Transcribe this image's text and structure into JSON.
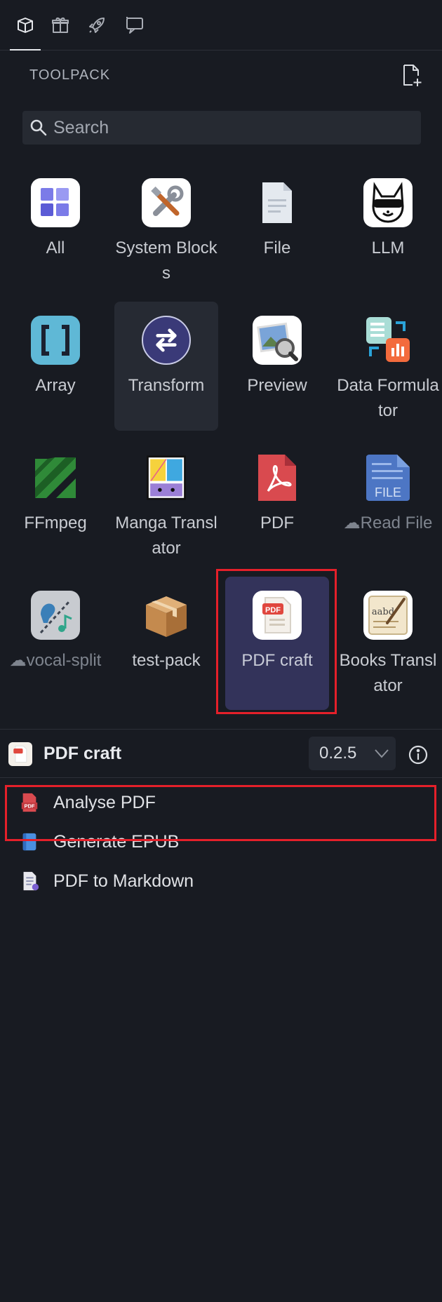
{
  "top_tabs": [
    {
      "name": "toolpack-tab",
      "icon": "box-icon",
      "active": true
    },
    {
      "name": "gift-tab",
      "icon": "gift-icon",
      "active": false
    },
    {
      "name": "rocket-tab",
      "icon": "rocket-icon",
      "active": false
    },
    {
      "name": "chat-tab",
      "icon": "chat-icon",
      "active": false
    }
  ],
  "toolpack": {
    "section_title": "TOOLPACK",
    "search_placeholder": "Search"
  },
  "packs": [
    {
      "label": "All",
      "icon": "all-grid-icon",
      "dim": false
    },
    {
      "label": "System Blocks",
      "icon": "tools-icon",
      "dim": false
    },
    {
      "label": "File",
      "icon": "file-icon",
      "dim": false
    },
    {
      "label": "LLM",
      "icon": "llm-fox-icon",
      "dim": false
    },
    {
      "label": "Array",
      "icon": "brackets-icon",
      "dim": false
    },
    {
      "label": "Transform",
      "icon": "transform-icon",
      "dim": false
    },
    {
      "label": "Preview",
      "icon": "preview-icon",
      "dim": false
    },
    {
      "label": "Data Formulator",
      "icon": "data-formulator-icon",
      "dim": false
    },
    {
      "label": "FFmpeg",
      "icon": "ffmpeg-icon",
      "dim": false
    },
    {
      "label": "Manga Translator",
      "icon": "manga-icon",
      "dim": false
    },
    {
      "label": "PDF",
      "icon": "pdf-icon",
      "dim": false
    },
    {
      "label": "Read File",
      "icon": "read-file-icon",
      "dim": true
    },
    {
      "label": "vocal-split",
      "icon": "vocal-split-icon",
      "dim": true
    },
    {
      "label": "test-pack",
      "icon": "package-box-icon",
      "dim": false
    },
    {
      "label": "PDF craft",
      "icon": "pdf-craft-icon",
      "dim": false
    },
    {
      "label": "Books Translator",
      "icon": "books-translator-icon",
      "dim": false
    }
  ],
  "selected_pack": {
    "title": "PDF craft",
    "version": "0.2.5"
  },
  "blocks": [
    {
      "label": "Analyse PDF",
      "icon": "pdf-file-icon"
    },
    {
      "label": "Generate EPUB",
      "icon": "epub-book-icon"
    },
    {
      "label": "PDF to Markdown",
      "icon": "markdown-doc-icon"
    }
  ],
  "colors": {
    "background": "#181b22",
    "selected_tile": "#33335a",
    "highlight": "#e5202a"
  }
}
